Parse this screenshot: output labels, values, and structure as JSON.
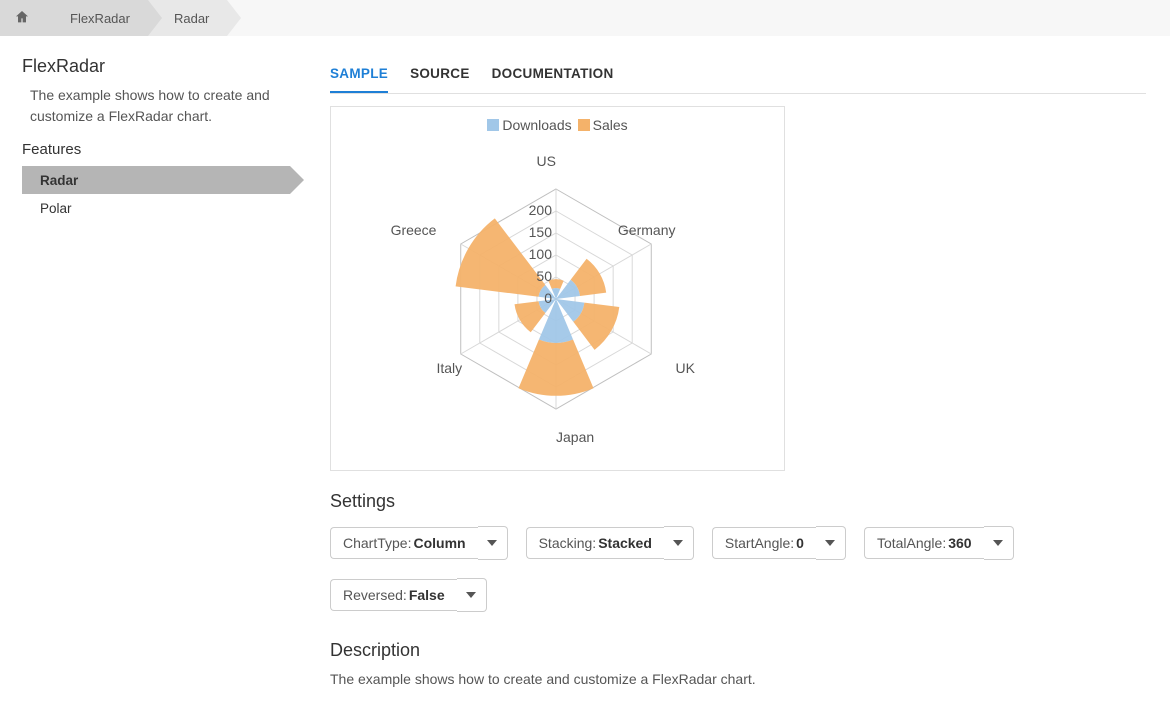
{
  "breadcrumb": {
    "item1": "FlexRadar",
    "item2": "Radar"
  },
  "sidebar": {
    "title": "FlexRadar",
    "desc": "The example shows how to create and customize a FlexRadar chart.",
    "features_label": "Features",
    "items": [
      "Radar",
      "Polar"
    ]
  },
  "tabs": [
    "SAMPLE",
    "SOURCE",
    "DOCUMENTATION"
  ],
  "legend": {
    "a": "Downloads",
    "b": "Sales"
  },
  "settings": {
    "heading": "Settings",
    "chartType": {
      "label": "ChartType: ",
      "value": "Column"
    },
    "stacking": {
      "label": "Stacking: ",
      "value": "Stacked"
    },
    "startAngle": {
      "label": "StartAngle: ",
      "value": "0"
    },
    "totalAngle": {
      "label": "TotalAngle: ",
      "value": "360"
    },
    "reversed": {
      "label": "Reversed: ",
      "value": "False"
    }
  },
  "description": {
    "heading": "Description",
    "text": "The example shows how to create and customize a FlexRadar chart."
  },
  "chart_data": {
    "type": "radar-column-stacked",
    "categories": [
      "US",
      "Germany",
      "UK",
      "Japan",
      "Italy",
      "Greece"
    ],
    "radial_ticks": [
      0,
      50,
      100,
      150,
      200
    ],
    "rmax": 250,
    "series": [
      {
        "name": "Downloads",
        "color": "#a1c7e8",
        "values": [
          25,
          55,
          65,
          100,
          40,
          40
        ]
      },
      {
        "name": "Sales",
        "color": "#f4b26a",
        "values": [
          20,
          60,
          80,
          120,
          55,
          190
        ]
      }
    ]
  }
}
